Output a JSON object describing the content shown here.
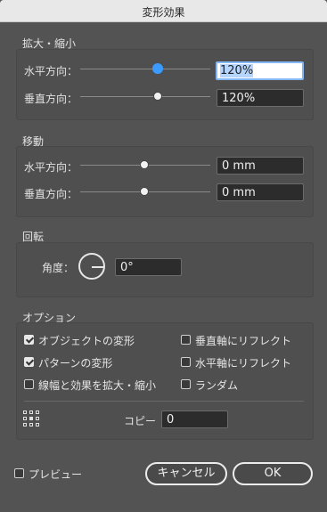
{
  "dialog": {
    "title": "変形効果"
  },
  "scale": {
    "label": "拡大・縮小",
    "horizontal": {
      "label": "水平方向：",
      "value": "120%",
      "level": 0.7
    },
    "vertical": {
      "label": "垂直方向：",
      "value": "120%",
      "level": 0.7
    }
  },
  "move": {
    "label": "移動",
    "horizontal": {
      "label": "水平方向：",
      "value": "0 mm",
      "level": 0.5
    },
    "vertical": {
      "label": "垂直方向：",
      "value": "0 mm",
      "level": 0.5
    }
  },
  "rotate": {
    "label": "回転",
    "angle_label": "角度：",
    "angle_value": "0°"
  },
  "options": {
    "label": "オプション",
    "transform_objects": {
      "label": "オブジェクトの変形",
      "checked": true
    },
    "transform_patterns": {
      "label": "パターンの変形",
      "checked": true
    },
    "scale_strokes": {
      "label": "線幅と効果を拡大・縮小",
      "checked": false
    },
    "reflect_y": {
      "label": "垂直軸にリフレクト",
      "checked": false
    },
    "reflect_x": {
      "label": "水平軸にリフレクト",
      "checked": false
    },
    "random": {
      "label": "ランダム",
      "checked": false
    },
    "copies_label": "コピー",
    "copies_value": "0"
  },
  "footer": {
    "preview_label": "プレビュー",
    "preview_checked": false,
    "cancel_label": "キャンセル",
    "ok_label": "OK"
  },
  "colors": {
    "slider_active": "#3b9bff",
    "focus_ring": "#84b7f4"
  },
  "icons": [
    "reference-point-icon",
    "angle-dial-icon",
    "checkbox-icon"
  ]
}
